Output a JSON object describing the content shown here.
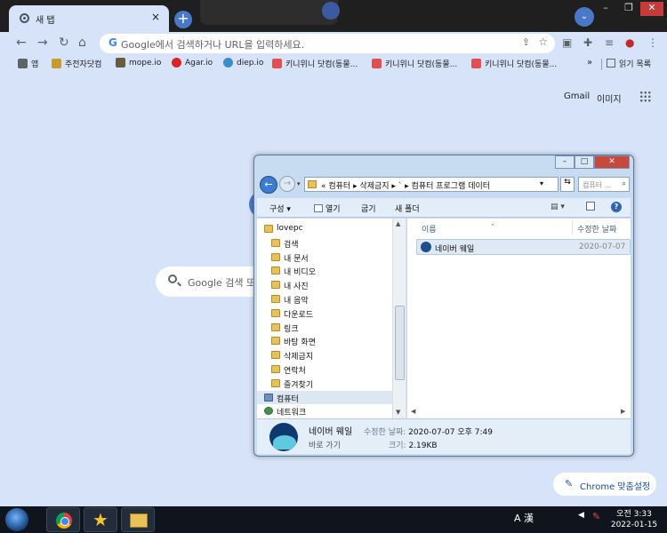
{
  "browser": {
    "tab_title": "새 탭",
    "tab_close": "×",
    "new_tab": "+",
    "omnibox_placeholder": "Google에서 검색하거나 URL을 입력하세요.",
    "bookmarks": [
      {
        "label": "앱",
        "color": "#5f6368"
      },
      {
        "label": "주전자닷컴",
        "color": "#c99a2e"
      },
      {
        "label": "mope.io",
        "color": "#6b5b3e"
      },
      {
        "label": "Agar.io",
        "color": "#d22"
      },
      {
        "label": "diep.io",
        "color": "#3a8dc9"
      },
      {
        "label": "키니위니 닷컴(동물...",
        "color": "#e05050"
      },
      {
        "label": "키니위니 닷컴(동물...",
        "color": "#e05050"
      },
      {
        "label": "키니위니 닷컴(동물...",
        "color": "#e05050"
      }
    ],
    "bookmarks_more": "»",
    "reading_list": "읽기 목록",
    "ntp_gmail": "Gmail",
    "ntp_images": "이미지",
    "search_placeholder": "Google 검색 또",
    "customize_label": "Chrome 맞춤설정"
  },
  "explorer": {
    "address_crumbs": "« 컴퓨터 ▸ 삭제금지 ▸ ` ▸ 컴퓨터 프로그램 데이터",
    "search_placeholder": "컴퓨터 ...",
    "commands": [
      "구성 ▾",
      "열기",
      "굽기",
      "새 폴더"
    ],
    "tree": [
      {
        "label": "lovepc",
        "type": "user"
      },
      {
        "label": "검색",
        "type": "folder"
      },
      {
        "label": "내 문서",
        "type": "folder"
      },
      {
        "label": "내 비디오",
        "type": "folder"
      },
      {
        "label": "내 사진",
        "type": "folder"
      },
      {
        "label": "내 음악",
        "type": "folder"
      },
      {
        "label": "다운로드",
        "type": "folder"
      },
      {
        "label": "링크",
        "type": "folder"
      },
      {
        "label": "바탕 화면",
        "type": "folder"
      },
      {
        "label": "삭제금지",
        "type": "folder"
      },
      {
        "label": "연락처",
        "type": "folder"
      },
      {
        "label": "즐겨찾기",
        "type": "folder"
      },
      {
        "label": "컴퓨터",
        "type": "pc"
      },
      {
        "label": "네트워크",
        "type": "net"
      }
    ],
    "columns": {
      "name": "이름",
      "modified": "수정한 날짜"
    },
    "file": {
      "name": "네이버 웨일",
      "modified": "2020-07-07"
    },
    "details": {
      "name": "네이버 웨일",
      "type": "바로 가기",
      "modified_label": "수정한 날짜:",
      "modified_value": "2020-07-07 오후 7:49",
      "size_label": "크기:",
      "size_value": "2.19KB"
    }
  },
  "taskbar": {
    "ime": "A 漢",
    "time": "오전 3:33",
    "date": "2022-01-15"
  }
}
